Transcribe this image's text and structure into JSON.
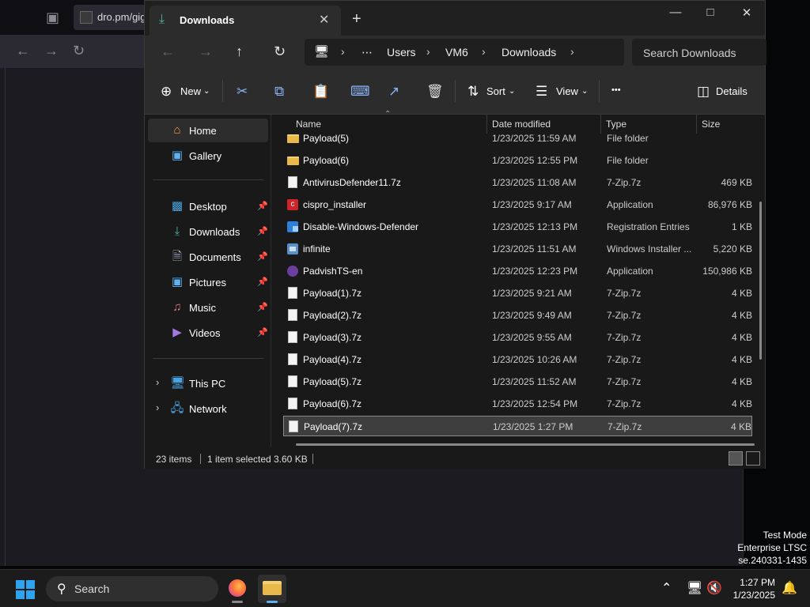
{
  "browser": {
    "tab_title": "dro.pm/gig"
  },
  "watermark": {
    "line1": "Test Mode",
    "line2": "Enterprise LTSC",
    "line3": "se.240331-1435"
  },
  "explorer": {
    "tab_title": "Downloads",
    "address": {
      "items": [
        "Users",
        "VM6",
        "Downloads"
      ]
    },
    "search_placeholder": "Search Downloads",
    "commands": {
      "new": "New",
      "sort": "Sort",
      "view": "View",
      "more": "•••",
      "details": "Details"
    },
    "sidebar": {
      "home": "Home",
      "gallery": "Gallery",
      "desktop": "Desktop",
      "downloads": "Downloads",
      "documents": "Documents",
      "pictures": "Pictures",
      "music": "Music",
      "videos": "Videos",
      "this_pc": "This PC",
      "network": "Network"
    },
    "columns": {
      "name": "Name",
      "date": "Date modified",
      "type": "Type",
      "size": "Size"
    },
    "files": [
      {
        "name": "Payload(5)",
        "date": "1/23/2025 11:59 AM",
        "type": "File folder",
        "size": "",
        "icon": "folder"
      },
      {
        "name": "Payload(6)",
        "date": "1/23/2025 12:55 PM",
        "type": "File folder",
        "size": "",
        "icon": "folder"
      },
      {
        "name": "AntivirusDefender11.7z",
        "date": "1/23/2025 11:08 AM",
        "type": "7-Zip.7z",
        "size": "469 KB",
        "icon": "file"
      },
      {
        "name": "cispro_installer",
        "date": "1/23/2025 9:17 AM",
        "type": "Application",
        "size": "86,976 KB",
        "icon": "app-red"
      },
      {
        "name": "Disable-Windows-Defender",
        "date": "1/23/2025 12:13 PM",
        "type": "Registration Entries",
        "size": "1 KB",
        "icon": "reg"
      },
      {
        "name": "infinite",
        "date": "1/23/2025 11:51 AM",
        "type": "Windows Installer ...",
        "size": "5,220 KB",
        "icon": "msi"
      },
      {
        "name": "PadvishTS-en",
        "date": "1/23/2025 12:23 PM",
        "type": "Application",
        "size": "150,986 KB",
        "icon": "app-purple"
      },
      {
        "name": "Payload(1).7z",
        "date": "1/23/2025 9:21 AM",
        "type": "7-Zip.7z",
        "size": "4 KB",
        "icon": "file"
      },
      {
        "name": "Payload(2).7z",
        "date": "1/23/2025 9:49 AM",
        "type": "7-Zip.7z",
        "size": "4 KB",
        "icon": "file"
      },
      {
        "name": "Payload(3).7z",
        "date": "1/23/2025 9:55 AM",
        "type": "7-Zip.7z",
        "size": "4 KB",
        "icon": "file"
      },
      {
        "name": "Payload(4).7z",
        "date": "1/23/2025 10:26 AM",
        "type": "7-Zip.7z",
        "size": "4 KB",
        "icon": "file"
      },
      {
        "name": "Payload(5).7z",
        "date": "1/23/2025 11:52 AM",
        "type": "7-Zip.7z",
        "size": "4 KB",
        "icon": "file"
      },
      {
        "name": "Payload(6).7z",
        "date": "1/23/2025 12:54 PM",
        "type": "7-Zip.7z",
        "size": "4 KB",
        "icon": "file"
      },
      {
        "name": "Payload(7).7z",
        "date": "1/23/2025 1:27 PM",
        "type": "7-Zip.7z",
        "size": "4 KB",
        "icon": "file",
        "selected": true
      }
    ],
    "status": {
      "items": "23 items",
      "selected": "1 item selected",
      "size": "3.60 KB"
    }
  },
  "taskbar": {
    "search": "Search",
    "time": "1:27 PM",
    "date": "1/23/2025"
  },
  "colors": {
    "accent": "#5fb2f2",
    "folder": "#e8b84a",
    "download_icon": "#4fb0a6"
  }
}
